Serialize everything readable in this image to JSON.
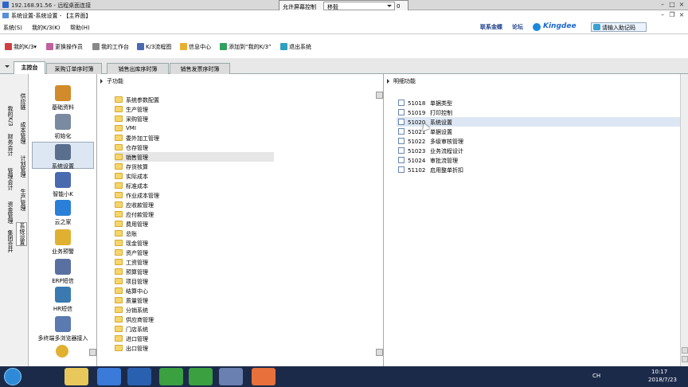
{
  "rdp": {
    "title": "192.168.91.56 - 远程桌面连接"
  },
  "share": {
    "label": "允许屏幕控制",
    "mode": "移毅",
    "count": "0"
  },
  "window": {
    "title": "系统设置-系统设置 - 【主界面】"
  },
  "menu": {
    "items": [
      "系统(S)",
      "我的K/3(K)",
      "帮助(H)"
    ]
  },
  "right_links": [
    "联系金蝶",
    "论坛"
  ],
  "brand": "Kingdee",
  "help": {
    "text": "请输入助记码"
  },
  "toolbar": {
    "items": [
      {
        "label": "我的K/3",
        "icon": "home-icon"
      },
      {
        "label": "更换操作员",
        "icon": "user-switch-icon"
      },
      {
        "label": "我的工作台",
        "icon": "desk-icon"
      },
      {
        "label": "K/3流程图",
        "icon": "flow-icon"
      },
      {
        "label": "信息中心",
        "icon": "info-icon"
      },
      {
        "label": "添加到“我的K/3”",
        "icon": "add-icon"
      },
      {
        "label": "退出系统",
        "icon": "exit-icon"
      }
    ]
  },
  "tabs": [
    "主控台",
    "采购订单序时簿",
    "销售出库序时簿",
    "销售发票序时簿"
  ],
  "left_vertical": [
    "我的K/3",
    "供应链",
    "财务会计",
    "成本管理",
    "计划管理",
    "管理会计",
    "资金管理",
    "生产管理",
    "系统设置",
    "集团合并"
  ],
  "nav": [
    {
      "label": "基础资料",
      "icon": "basic-data-icon",
      "color": "#d28b2b"
    },
    {
      "label": "初始化",
      "icon": "init-gear-icon",
      "color": "#7a8aa0"
    },
    {
      "label": "系统设置",
      "icon": "system-settings-icon",
      "color": "#5a6e8e"
    },
    {
      "label": "智能小K",
      "icon": "smart-k-icon",
      "color": "#4a6ab0"
    },
    {
      "label": "云之家",
      "icon": "cloud-home-icon",
      "color": "#2a80d8"
    },
    {
      "label": "业务预警",
      "icon": "business-alert-icon",
      "color": "#e0b030"
    },
    {
      "label": "ERP短信",
      "icon": "erp-sms-icon",
      "color": "#5a70a0"
    },
    {
      "label": "HR短信",
      "icon": "hr-sms-icon",
      "color": "#3a7ab0"
    },
    {
      "label": "多终端多浏览器接入",
      "icon": "multi-terminal-icon",
      "color": "#5a7ab0"
    }
  ],
  "sub_panel": {
    "title": "子功能",
    "selected": "销售管理",
    "items": [
      "系统参数配置",
      "生产管理",
      "采购管理",
      "VMI",
      "委外加工管理",
      "仓存管理",
      "销售管理",
      "存货核算",
      "实际成本",
      "标准成本",
      "作业成本管理",
      "应收款管理",
      "应付款管理",
      "费用管理",
      "总账",
      "现金管理",
      "资产管理",
      "工资管理",
      "预算管理",
      "项目管理",
      "结算中心",
      "质量管理",
      "分销系统",
      "供应商管理",
      "门店系统",
      "进口管理",
      "出口管理"
    ]
  },
  "detail_panel": {
    "title": "明细功能",
    "selected": "51020",
    "items": [
      {
        "code": "51018",
        "label": "单据类型"
      },
      {
        "code": "51019",
        "label": "打印控制"
      },
      {
        "code": "51020",
        "label": "系统设置"
      },
      {
        "code": "51021",
        "label": "单据设置"
      },
      {
        "code": "51022",
        "label": "多级审核管理"
      },
      {
        "code": "51023",
        "label": "业务流程设计"
      },
      {
        "code": "51024",
        "label": "审批流管理"
      },
      {
        "code": "51102",
        "label": "启用整单折扣"
      }
    ]
  },
  "taskbar": {
    "time": "10:17",
    "date": "2018/7/23",
    "lang": "CH"
  }
}
